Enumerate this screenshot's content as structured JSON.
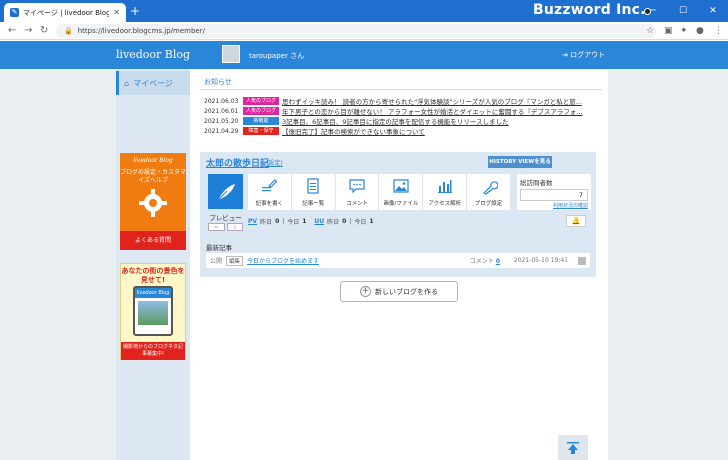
{
  "browser": {
    "tab_title": "マイページ | livedoor Blog",
    "url": "https://livedoor.blogcms.jp/member/",
    "watermark": "Buzzword Inc."
  },
  "header": {
    "logo": "livedoor Blog",
    "username": "taroupaper さん",
    "logout": "ログアウト"
  },
  "sidebar": {
    "mypage": "マイページ",
    "banner1": {
      "logo": "livedoor Blog",
      "text": "ブログの設定・カスタマイズヘルプ",
      "footer": "よくある質問"
    },
    "banner2": {
      "title": "あなたの街の景色を見せて!",
      "phone_logo": "livedoor Blog",
      "footer": "撮影地からのブログネタ記事募集中!"
    }
  },
  "notices": {
    "heading": "お知らせ",
    "items": [
      {
        "date": "2021.06.03",
        "badge": "人気のブログ",
        "badge_color": "#e0239f",
        "text": "思わずイッキ読み！ 読者の方から寄せられた\"浮気体験談\"シリーズが人気のブログ『マンガと私と旅..."
      },
      {
        "date": "2021.06.01",
        "badge": "人気のブログ",
        "badge_color": "#e0239f",
        "text": "年下男子との恋から目が離せない！ アラフォー女性が婚活とダイエットに奮闘する『デブスアラフォ..."
      },
      {
        "date": "2021.05.20",
        "badge": "新機能",
        "badge_color": "#2a86d8",
        "text": "3記事目、6記事目、9記事目に指定の記事を配信する機能をリリースしました"
      },
      {
        "date": "2021.04.29",
        "badge": "障害・保守",
        "badge_color": "#e0231c",
        "text": "【復旧完了】記事の検索ができない事象について"
      }
    ]
  },
  "blog": {
    "title": "太郎の散歩日記",
    "edit": "(設定)",
    "history_button": "HISTORY VIEWを見る",
    "preview_label": "プレビュー",
    "tools": [
      "記事を書く",
      "記事一覧",
      "コメント",
      "画像/ファイル",
      "アクセス解析",
      "ブログ設定"
    ],
    "visitors": {
      "label": "総訪問者数",
      "value": "7",
      "link": "利用状況の確認"
    },
    "stats": {
      "pv": "PV",
      "pv_yesterday": "昨日",
      "pv_y_val": "0",
      "pv_today": "今日",
      "pv_t_val": "1",
      "uu": "UU",
      "uu_yesterday": "昨日",
      "uu_y_val": "0",
      "uu_today": "今日",
      "uu_t_val": "1"
    },
    "recent": {
      "heading": "最新記事",
      "status": "公開",
      "edit": "編集",
      "title": "今日からブログを始めます",
      "comment_label": "コメント",
      "comment_count": "0",
      "date": "2021-05-10 19:41"
    }
  },
  "new_blog": "新しいブログを作る"
}
